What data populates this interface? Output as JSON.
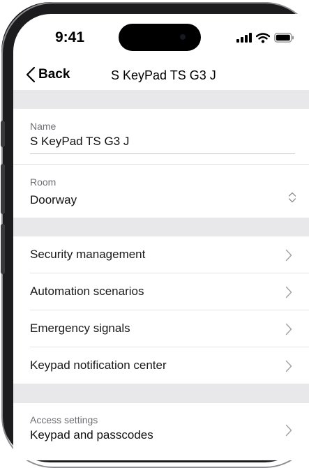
{
  "status_bar": {
    "time": "9:41"
  },
  "nav": {
    "back_label": "Back",
    "title": "S KeyPad TS G3 J"
  },
  "fields": {
    "name": {
      "label": "Name",
      "value": "S KeyPad TS G3 J"
    },
    "room": {
      "label": "Room",
      "value": "Doorway"
    }
  },
  "menu": [
    {
      "label": "Security management"
    },
    {
      "label": "Automation scenarios"
    },
    {
      "label": "Emergency signals"
    },
    {
      "label": "Keypad notification center"
    }
  ],
  "access": {
    "label": "Access settings",
    "value": "Keypad and passcodes"
  },
  "colors": {
    "separator": "#e8e8ea",
    "text": "#111111",
    "secondary": "#6e6e73",
    "frame": "#1c1c1e"
  },
  "icons": [
    "back-chevron-icon",
    "cellular-signal-icon",
    "wifi-icon",
    "battery-icon",
    "chevron-right-icon",
    "chevron-updown-icon"
  ]
}
